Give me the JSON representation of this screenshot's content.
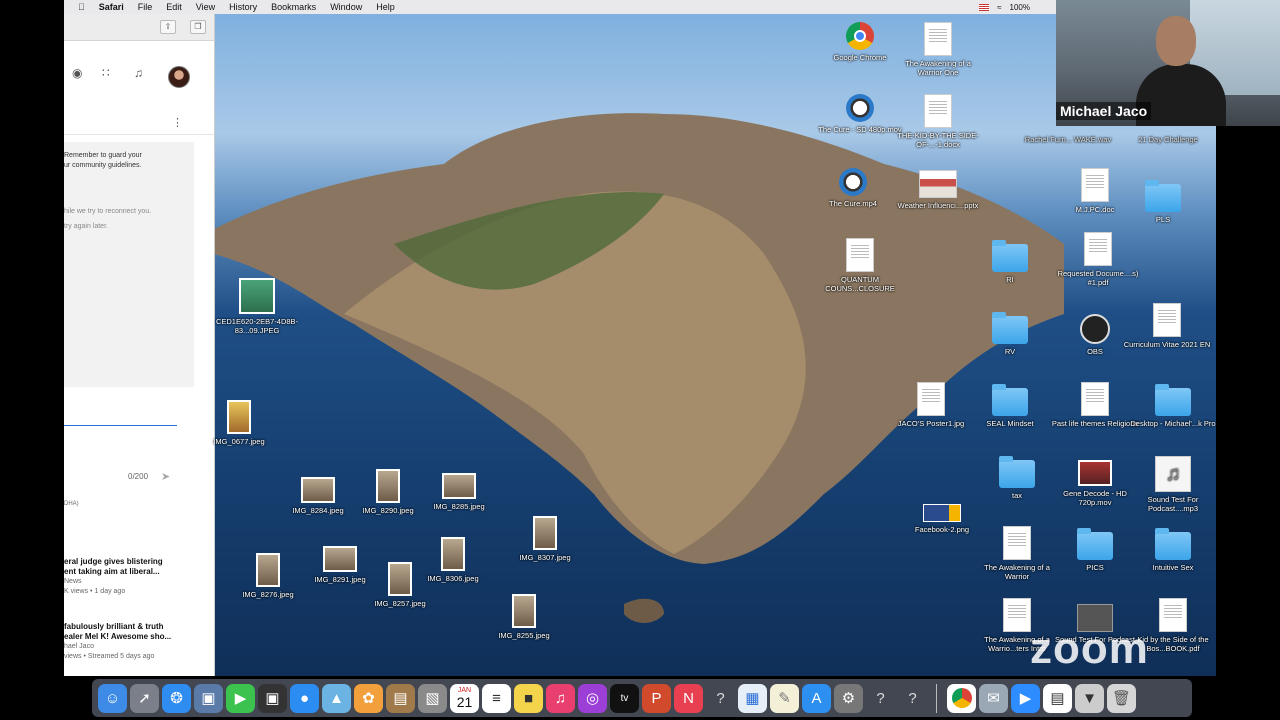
{
  "menubar": {
    "apple": "",
    "app": "Safari",
    "items": [
      "File",
      "Edit",
      "View",
      "History",
      "Bookmarks",
      "Window",
      "Help"
    ],
    "battery": "100%"
  },
  "safari": {
    "chat_notice_lines": [
      "Remember to guard your",
      "ur community guidelines."
    ],
    "reconnect": "hile we try to reconnect you.",
    "retry": "try again later.",
    "counter": "0/200",
    "handle": "DHA)",
    "videos": [
      {
        "title1": "eral judge gives blistering",
        "title2": "ent taking aim at liberal...",
        "meta1": "News",
        "meta2": "K views • 1 day ago"
      },
      {
        "title1": "fabulously brilliant & truth",
        "title2": "ealer Mel K! Awesome sho...",
        "meta1": "hael Jaco",
        "meta2": "views • Streamed 5 days ago"
      }
    ]
  },
  "desktop_icons": {
    "ced": "CED1E620-2EB7-4D8B-83...09.JPEG",
    "img0677": "IMG_0677.jpeg",
    "img8284": "IMG_8284.jpeg",
    "img8290": "IMG_8290.jpeg",
    "img8285": "IMG_8285.jpeg",
    "img8307": "IMG_8307.jpeg",
    "img8276": "IMG_8276.jpeg",
    "img8291": "IMG_8291.jpeg",
    "img8257": "IMG_8257.jpeg",
    "img8306": "IMG_8306.jpeg",
    "img8255": "IMG_8255.jpeg",
    "chrome": "Google Chrome",
    "awak1": "The Awakening of a Warrior One",
    "cure1": "The Cure - SD 480p.mov",
    "kid1": "THE-KID-BY-THE SIDE-OF-...-1.docx",
    "cure2": "The Cure.mp4",
    "weather": "Weather Influenci....pptx",
    "quantum": "QUANTUM COUNS...CLOSURE",
    "rachel": "Rachel Furn... WAKE.wav",
    "challenge": "21 Day Challenge",
    "mpc": "M.J.PC.doc",
    "pls": "PLS",
    "ri": "RI",
    "req": "Requested Docume....s) #1.pdf",
    "rv": "RV",
    "obs": "OBS",
    "cv": "Curriculum Vitae 2021 EN",
    "jaco": "JACO'S Poster1.jpg",
    "seal": "SEAL Mindset",
    "past": "Past life themes Religions",
    "deskpro": "Desktop - Michael'...k Pro",
    "tax": "tax",
    "gene": "Gene Decode - HD 720p.mov",
    "sound1": "Sound Test For Podcast....mp3",
    "fb": "Facebook-2.png",
    "awak2": "The Awakening of a Warrior",
    "pics": "PICS",
    "intuitive": "Intuitive Sex",
    "awak3": "The Awakening of a Warrio...ters Intro",
    "sound2": "Sound Test For Podcast",
    "kid2": "Kid by the Side of the Bos...BOOK.pdf"
  },
  "camera": {
    "name": "Michael Jaco"
  },
  "watermark": "zoom",
  "dock": {
    "calendar_day": "21",
    "calendar_month": "JAN"
  }
}
